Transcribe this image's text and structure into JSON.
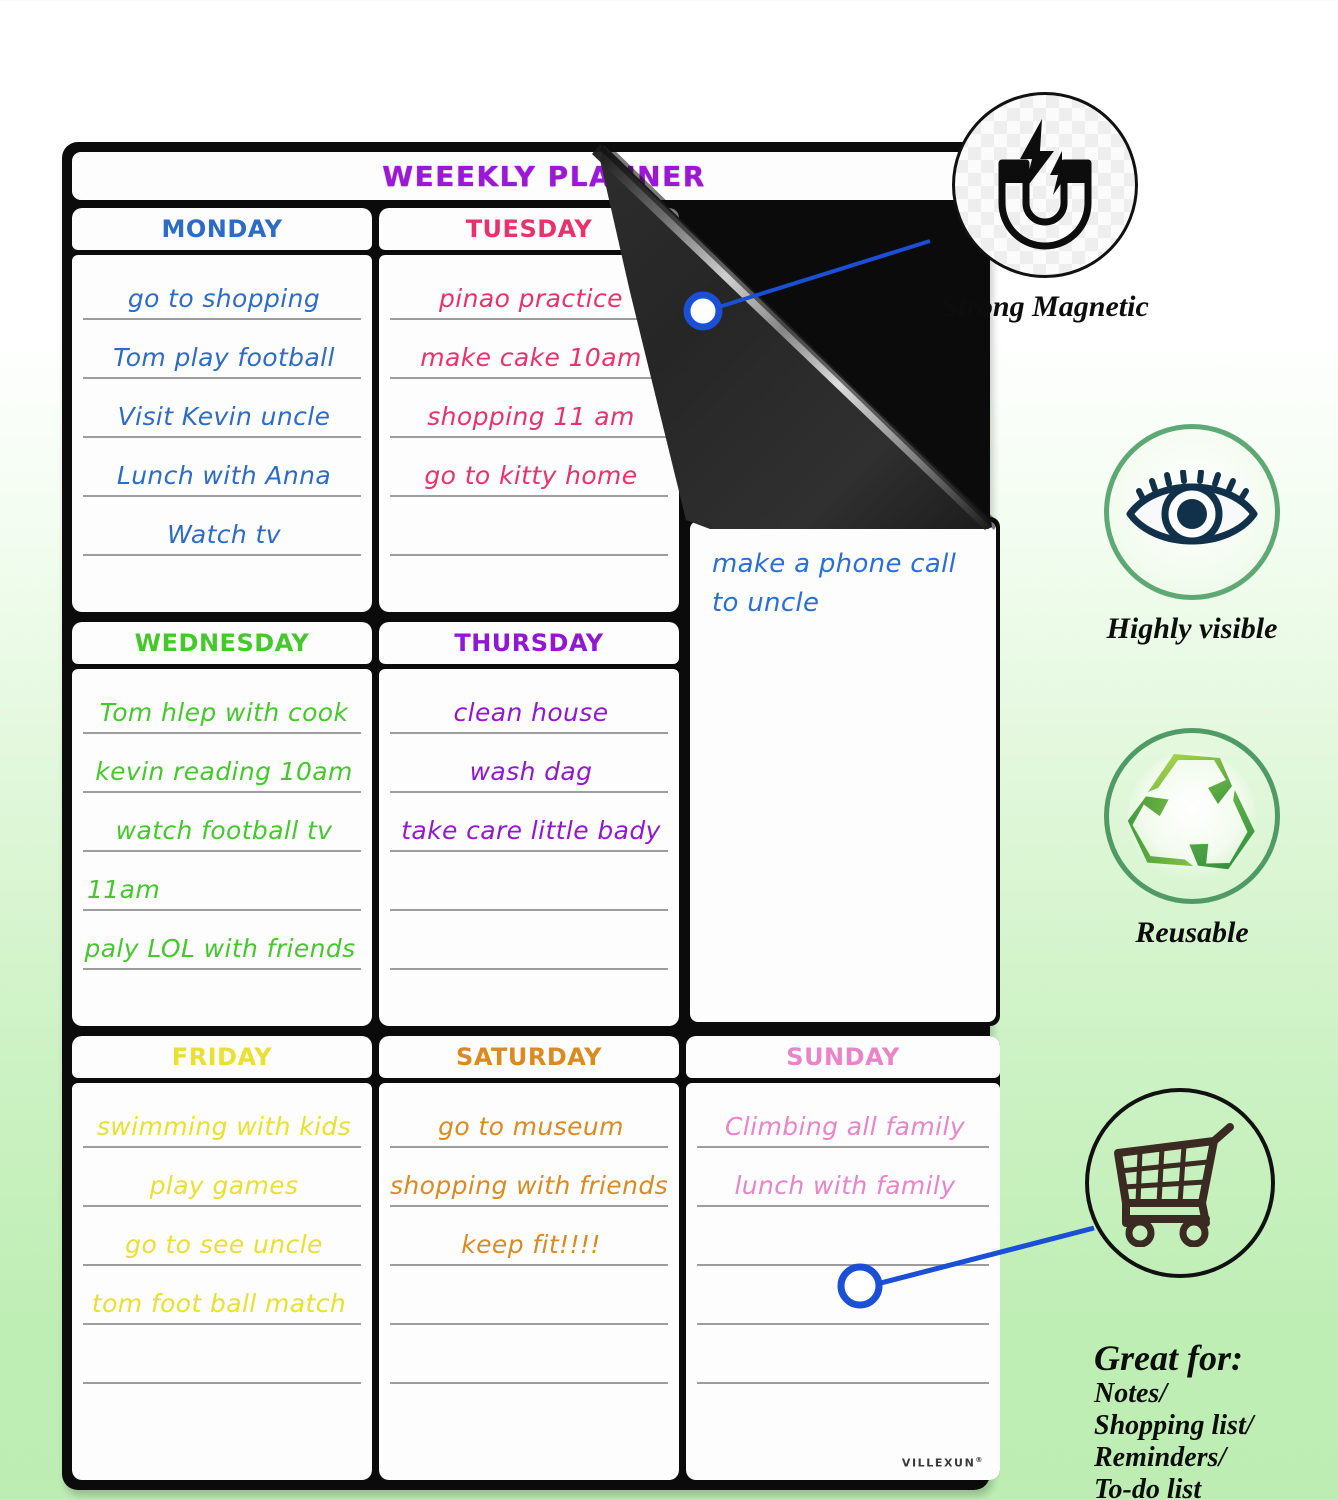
{
  "board": {
    "title": "WEEEKLY PLANNER",
    "brand": "VILLEXUN",
    "brand_mark": "®",
    "days": [
      {
        "name": "MONDAY",
        "color": "#2e6bc4",
        "entries": [
          "go to shopping",
          "Tom play football",
          "Visit Kevin uncle",
          "Lunch with Anna",
          "Watch tv",
          ""
        ]
      },
      {
        "name": "TUESDAY",
        "color": "#e8326b",
        "entries": [
          "pinao practice",
          "make cake 10am",
          "shopping 11 am",
          "go to kitty home",
          "",
          ""
        ]
      },
      {
        "name": "WEDNESDAY",
        "color": "#46c72e",
        "entries": [
          "Tom hlep with cook",
          "kevin reading 10am",
          "watch football tv",
          "11am",
          "paly LOL with friends",
          ""
        ]
      },
      {
        "name": "THURSDAY",
        "color": "#9018cf",
        "entries": [
          "clean house",
          "wash dag",
          "take care little bady",
          "",
          "",
          ""
        ]
      },
      {
        "name": "FRIDAY",
        "color": "#e8e032",
        "entries": [
          "swimming with kids",
          "play games",
          "go to see uncle",
          "tom foot ball match",
          "",
          ""
        ]
      },
      {
        "name": "SATURDAY",
        "color": "#d98a22",
        "entries": [
          "go to museum",
          "shopping with friends",
          "keep fit!!!!",
          "",
          "",
          ""
        ]
      },
      {
        "name": "SUNDAY",
        "color": "#e884c8",
        "entries": [
          "Climbing all family",
          "lunch with family",
          "",
          "",
          "",
          ""
        ]
      }
    ],
    "notes": {
      "line1": "make a phone call",
      "line2": "to uncle"
    }
  },
  "features": [
    {
      "id": "magnetic",
      "icon": "horseshoe-magnet-icon",
      "caption": "Strong Magnetic"
    },
    {
      "id": "visible",
      "icon": "eye-icon",
      "caption": "Highly visible"
    },
    {
      "id": "reusable",
      "icon": "recycle-icon",
      "caption": "Reusable"
    },
    {
      "id": "cart",
      "icon": "shopping-cart-icon",
      "caption": ""
    }
  ],
  "great_for": {
    "title": "Great for:",
    "lines": [
      "Notes/",
      "Shopping list/",
      "Reminders/",
      "To-do list"
    ]
  },
  "colors": {
    "callout": "#1a4fd6",
    "board_frame": "#0b0b0b",
    "rule_line": "#9d9d9d",
    "bg_top": "#ffffff",
    "bg_bottom": "#bdedb3"
  }
}
